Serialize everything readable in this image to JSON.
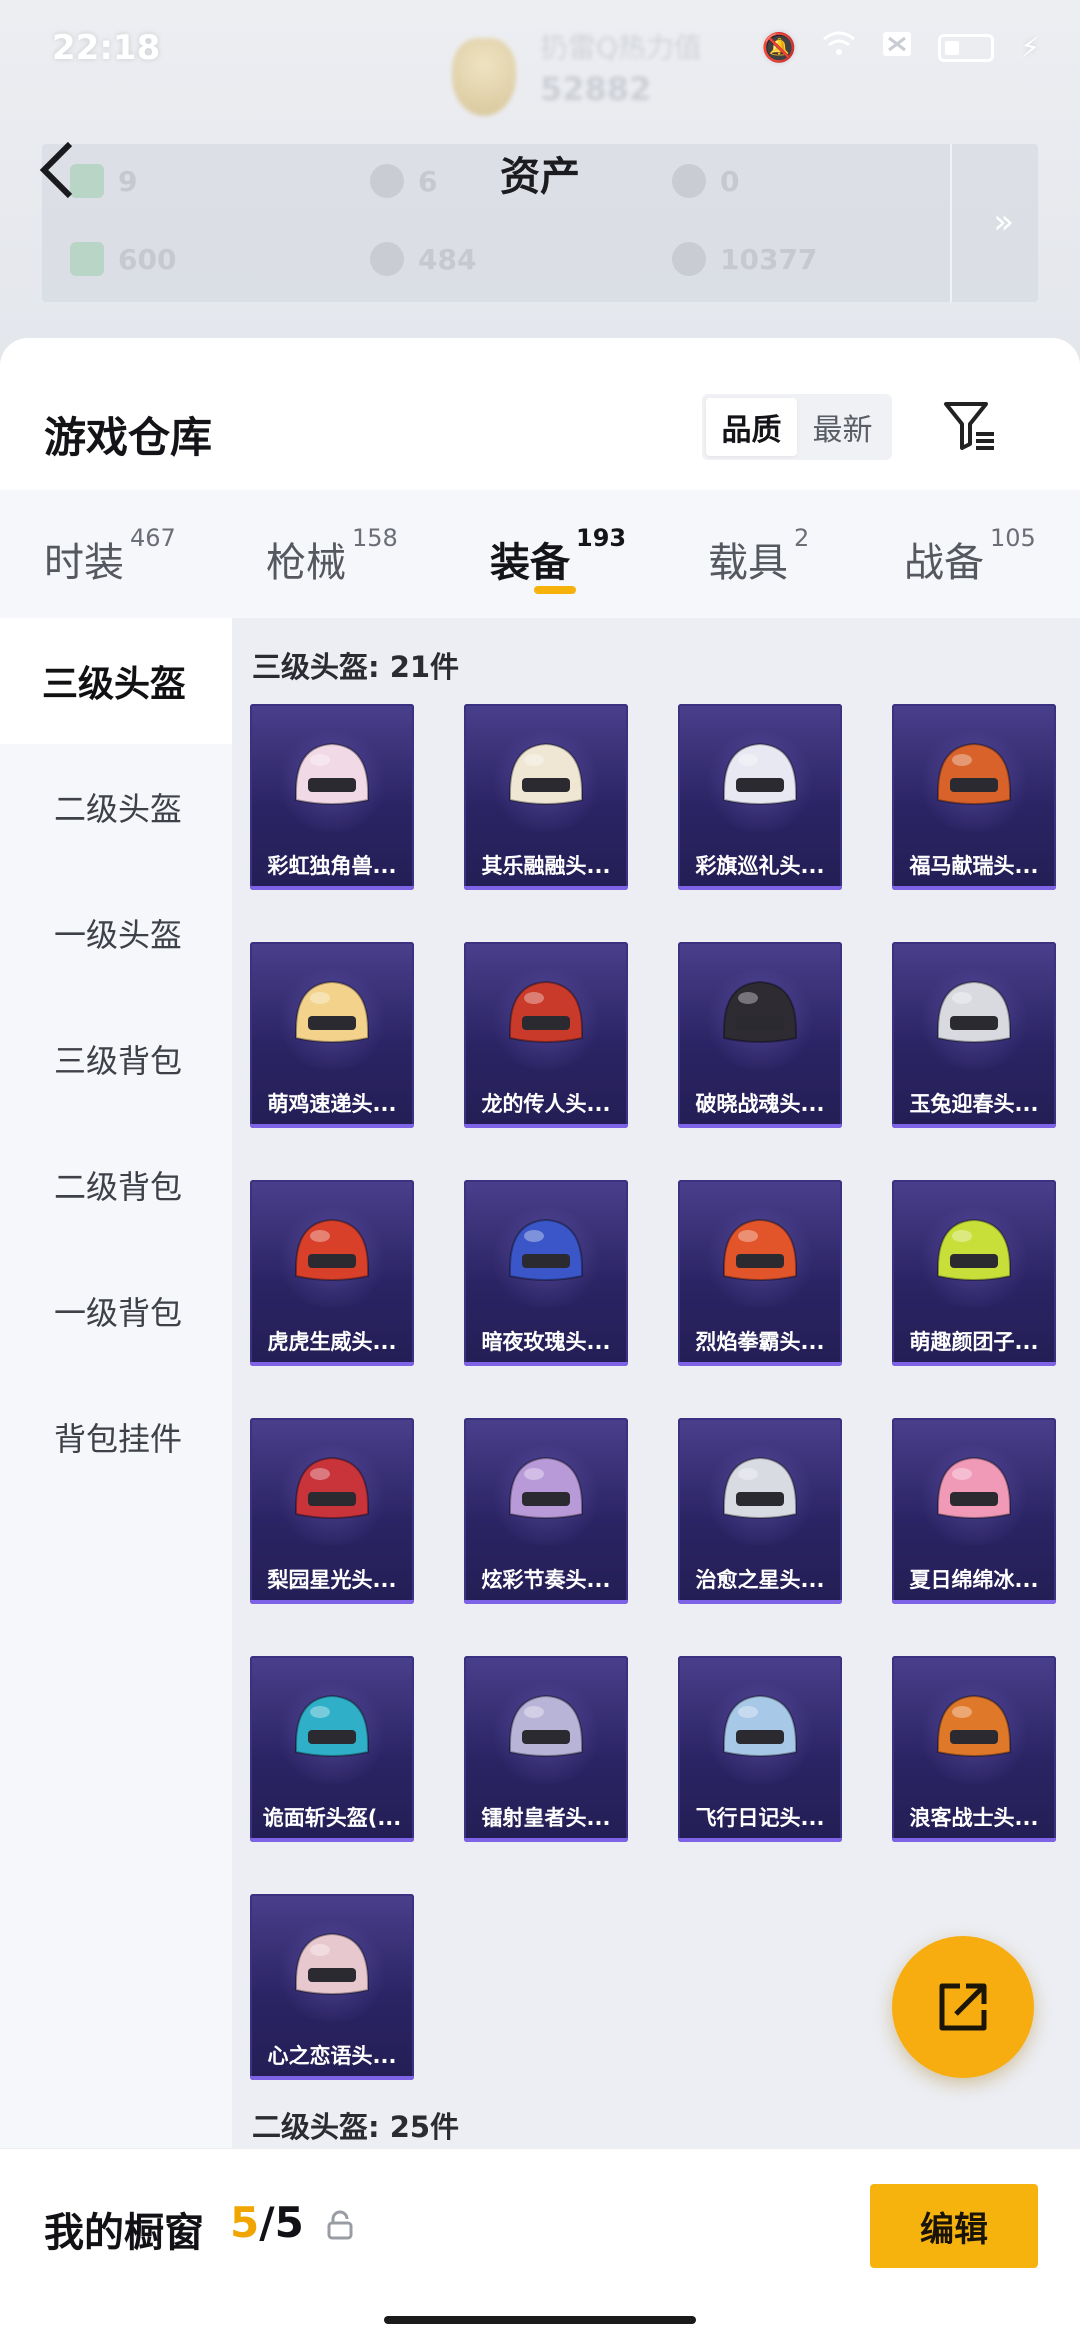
{
  "status_bar": {
    "time": "22:18"
  },
  "hero": {
    "title": "扔雷Q热力值",
    "score": "52882"
  },
  "header": {
    "title": "资产"
  },
  "assets": [
    {
      "icon": "ticket-icon",
      "value": "9"
    },
    {
      "icon": "coin-icon",
      "value": "6"
    },
    {
      "icon": "token-icon",
      "value": "0"
    },
    {
      "icon": "card-icon",
      "value": "600"
    },
    {
      "icon": "silver-coin-icon",
      "value": "484"
    },
    {
      "icon": "gold-coin-icon",
      "value": "10377"
    }
  ],
  "warehouse": {
    "title": "游戏仓库",
    "sort_quality": "品质",
    "sort_latest": "最新"
  },
  "tabs": [
    {
      "label": "时装",
      "count": "467"
    },
    {
      "label": "枪械",
      "count": "158"
    },
    {
      "label": "装备",
      "count": "193",
      "active": true
    },
    {
      "label": "载具",
      "count": "2"
    },
    {
      "label": "战备",
      "count": "105"
    }
  ],
  "sidebar": [
    {
      "label": "三级头盔",
      "active": true
    },
    {
      "label": "二级头盔"
    },
    {
      "label": "一级头盔"
    },
    {
      "label": "三级背包"
    },
    {
      "label": "二级背包"
    },
    {
      "label": "一级背包"
    },
    {
      "label": "背包挂件"
    }
  ],
  "section_level3": {
    "title": "三级头盔: 21件"
  },
  "items": [
    {
      "label": "彩虹独角兽...",
      "color": "#f1d9e6"
    },
    {
      "label": "其乐融融头...",
      "color": "#efe6d4"
    },
    {
      "label": "彩旗巡礼头...",
      "color": "#e7e8f2"
    },
    {
      "label": "福马献瑞头...",
      "color": "#d8622a"
    },
    {
      "label": "萌鸡速递头...",
      "color": "#f3d38b"
    },
    {
      "label": "龙的传人头...",
      "color": "#c93a2a"
    },
    {
      "label": "破晓战魂头...",
      "color": "#2e2b33"
    },
    {
      "label": "玉兔迎春头...",
      "color": "#d9dadf"
    },
    {
      "label": "虎虎生威头...",
      "color": "#d8402a"
    },
    {
      "label": "暗夜玫瑰头...",
      "color": "#3a56c8"
    },
    {
      "label": "烈焰拳霸头...",
      "color": "#e2552a"
    },
    {
      "label": "萌趣颜团子...",
      "color": "#c8df3a"
    },
    {
      "label": "梨园星光头...",
      "color": "#c8343a"
    },
    {
      "label": "炫彩节奏头...",
      "color": "#b89ad8"
    },
    {
      "label": "治愈之星头...",
      "color": "#d9dbe2"
    },
    {
      "label": "夏日绵绵冰...",
      "color": "#f09ab8"
    },
    {
      "label": "诡面斩头盔(...",
      "color": "#2fb0c8"
    },
    {
      "label": "镭射皇者头...",
      "color": "#b8b4d8"
    },
    {
      "label": "飞行日记头...",
      "color": "#a8c8e8"
    },
    {
      "label": "浪客战士头...",
      "color": "#e0782a"
    },
    {
      "label": "心之恋语头...",
      "color": "#e8c8cf"
    }
  ],
  "section_level2": {
    "title": "二级头盔: 25件"
  },
  "showcase": {
    "label": "我的橱窗",
    "current": "5",
    "total": "/5"
  },
  "edit_button": {
    "label": "编辑"
  }
}
